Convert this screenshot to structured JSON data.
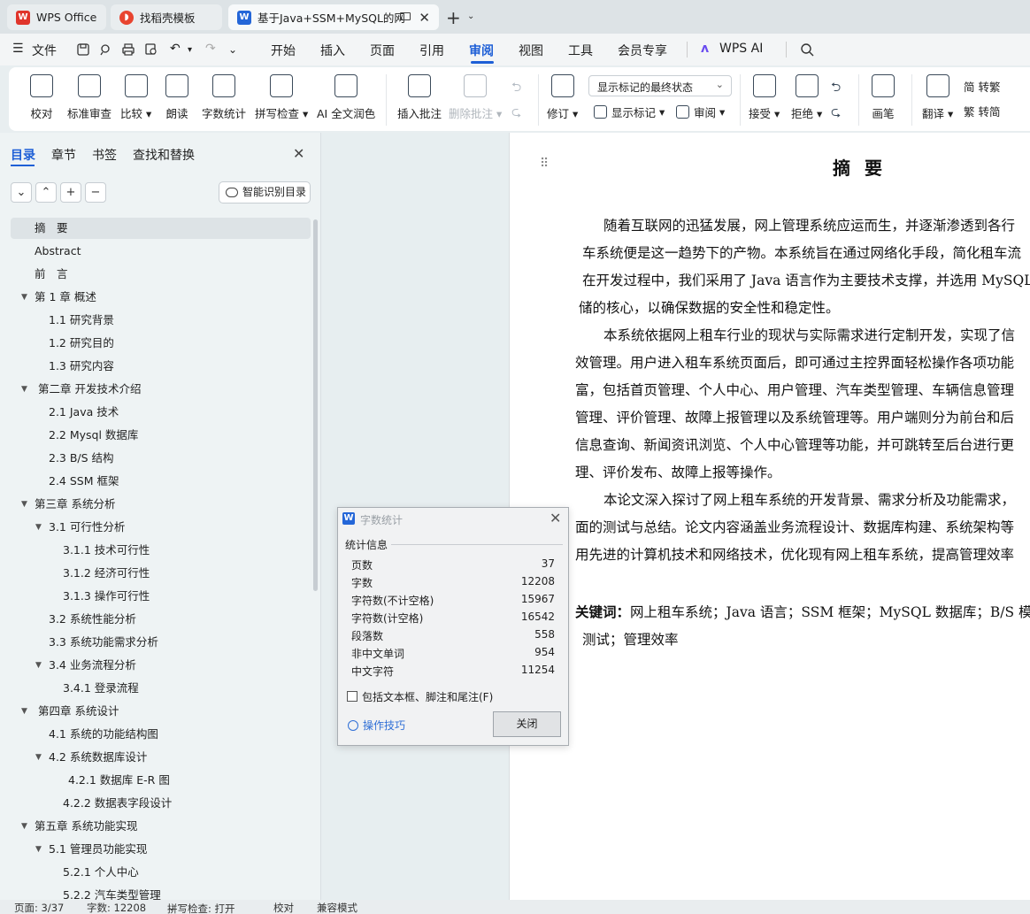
{
  "tabs": [
    {
      "label": "WPS Office"
    },
    {
      "label": "找稻壳模板"
    },
    {
      "label": "基于Java+SSM+MySQL的网"
    }
  ],
  "menu": {
    "file": "文件",
    "items": [
      "开始",
      "插入",
      "页面",
      "引用",
      "审阅",
      "视图",
      "工具",
      "会员专享"
    ],
    "active": "审阅",
    "ai": "WPS AI"
  },
  "ribbon": {
    "proofread": "校对",
    "std_review": "标准审查",
    "compare": "比较",
    "read_aloud": "朗读",
    "word_count": "字数统计",
    "spell_check": "拼写检查",
    "ai_polish": "AI 全文润色",
    "insert_comment": "插入批注",
    "delete_comment": "删除批注",
    "track_changes": "修订",
    "display_mode": "显示标记的最终状态",
    "show_markup": "显示标记",
    "review": "审阅",
    "accept": "接受",
    "reject": "拒绝",
    "pen": "画笔",
    "translate": "翻译",
    "to_traditional": "简 转繁",
    "to_simplified": "繁 转简"
  },
  "left_panel": {
    "tabs": [
      "目录",
      "章节",
      "书签",
      "查找和替换"
    ],
    "smart_toc": "智能识别目录",
    "toc": [
      "摘　要",
      "Abstract",
      "前　言",
      "第 1 章  概述",
      "1.1  研究背景",
      "1.2  研究目的",
      "1.3  研究内容",
      "第二章  开发技术介绍",
      "2.1 Java 技术",
      "2.2 Mysql 数据库",
      "2.3 B/S 结构",
      "2.4 SSM 框架",
      "第三章  系统分析",
      "3.1  可行性分析",
      "3.1.1    技术可行性",
      "3.1.2  经济可行性",
      "3.1.3  操作可行性",
      "3.2  系统性能分析",
      "3.3  系统功能需求分析",
      "3.4  业务流程分析",
      "3.4.1 登录流程",
      "第四章  系统设计",
      "4.1  系统的功能结构图",
      "4.2  系统数据库设计",
      "4.2.1    数据库 E-R 图",
      "4.2.2    数据表字段设计",
      "第五章  系统功能实现",
      "5.1 管理员功能实现",
      "5.2.1  个人中心",
      "5.2.2  汽车类型管理"
    ]
  },
  "document": {
    "title": "摘要",
    "lines": [
      "随着互联网的迅猛发展，网上管理系统应运而生，并逐渐渗透到各行",
      "车系统便是这一趋势下的产物。本系统旨在通过网络化手段，简化租车流",
      "在开发过程中，我们采用了 Java 语言作为主要技术支撑，并选用 MySQL",
      "储的核心，以确保数据的安全性和稳定性。",
      "本系统依据网上租车行业的现状与实际需求进行定制开发，实现了信",
      "效管理。用户进入租车系统页面后，即可通过主控界面轻松操作各项功能",
      "富，包括首页管理、个人中心、用户管理、汽车类型管理、车辆信息管理",
      "管理、评价管理、故障上报管理以及系统管理等。用户端则分为前台和后",
      "信息查询、新闻资讯浏览、个人中心管理等功能，并可跳转至后台进行更",
      "理、评价发布、故障上报等操作。",
      "本论文深入探讨了网上租车系统的开发背景、需求分析及功能需求，",
      "面的测试与总结。论文内容涵盖业务流程设计、数据库构建、系统架构等",
      "用先进的计算机技术和网络技术，优化现有网上租车系统，提高管理效率"
    ],
    "keywords_label": "关键词：",
    "keywords": "网上租车系统；Java 语言；SSM 框架；MySQL 数据库；B/S 模式",
    "keywords_line2": "测试；管理效率"
  },
  "dialog": {
    "title": "字数统计",
    "group": "统计信息",
    "stats": [
      {
        "label": "页数",
        "value": "37"
      },
      {
        "label": "字数",
        "value": "12208"
      },
      {
        "label": "字符数(不计空格)",
        "value": "15967"
      },
      {
        "label": "字符数(计空格)",
        "value": "16542"
      },
      {
        "label": "段落数",
        "value": "558"
      },
      {
        "label": "非中文单词",
        "value": "954"
      },
      {
        "label": "中文字符",
        "value": "11254"
      }
    ],
    "checkbox": "包括文本框、脚注和尾注(F)",
    "tips": "操作技巧",
    "close": "关闭"
  },
  "status": {
    "page": "页面: 3/37",
    "words": "字数: 12208",
    "spell": "拼写检查: 打开",
    "proof": "校对",
    "compat": "兼容模式"
  },
  "colors": {
    "accent": "#1e5fd6",
    "wps_red": "#e0352b",
    "docer_red": "#e8442f",
    "word_blue": "#2466d8"
  }
}
